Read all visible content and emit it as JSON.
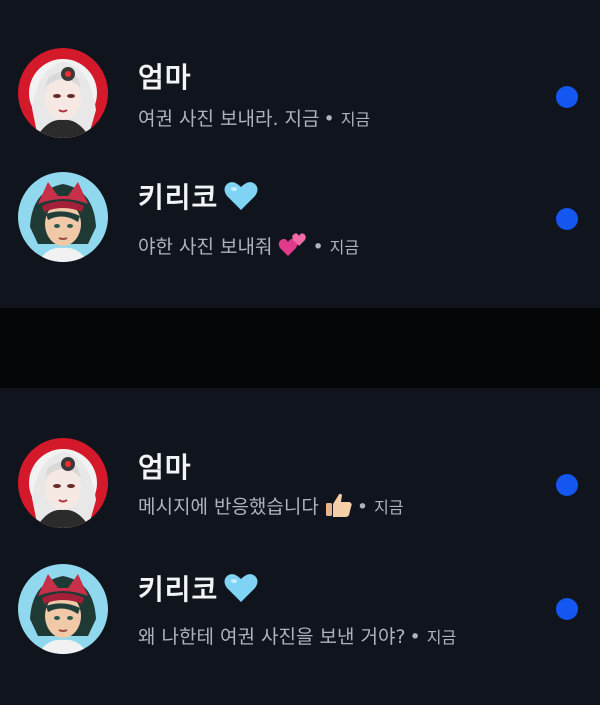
{
  "conversations": [
    {
      "name": "엄마",
      "name_emoji": "",
      "message": "여권 사진 보내라. 지금",
      "message_emoji": "",
      "separator": "•",
      "time": "지금",
      "unread": true,
      "avatar_icon": "mom-avatar"
    },
    {
      "name": "키리코",
      "name_emoji": "light-blue-heart-icon",
      "message": "야한 사진 보내줘",
      "message_emoji": "two-hearts-icon",
      "separator": "•",
      "time": "지금",
      "unread": true,
      "avatar_icon": "kiriko-avatar"
    },
    {
      "name": "엄마",
      "name_emoji": "",
      "message": "메시지에 반응했습니다",
      "message_emoji": "thumbs-up-icon",
      "separator": "•",
      "time": "지금",
      "unread": true,
      "avatar_icon": "mom-avatar"
    },
    {
      "name": "키리코",
      "name_emoji": "light-blue-heart-icon",
      "message": "왜 나한테 여권 사진을 보낸 거야?",
      "message_emoji": "",
      "separator": "•",
      "time": "지금",
      "unread": true,
      "avatar_icon": "kiriko-avatar"
    }
  ],
  "colors": {
    "panel_bg": "#10141c",
    "unread_dot": "#1456f0",
    "heart": "#7fd4f5",
    "name_text": "#f3f4f6",
    "message_text": "#aeb3bd"
  }
}
